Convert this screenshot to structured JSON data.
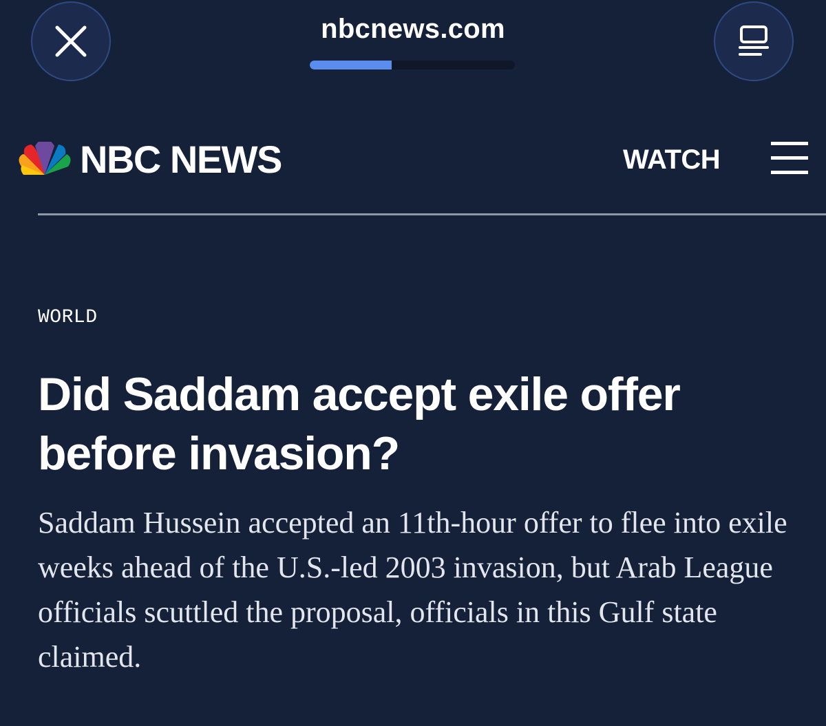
{
  "browser": {
    "url": "nbcnews.com",
    "load_progress": 0.4,
    "close_icon": "close-icon",
    "reader_icon": "reader-mode-icon"
  },
  "site": {
    "logo_text": "NBC NEWS",
    "watch_label": "WATCH",
    "menu_icon": "hamburger-menu-icon"
  },
  "article": {
    "section": "WORLD",
    "headline": "Did Saddam accept exile offer before invasion?",
    "summary": "Saddam Hussein accepted an 11th-hour offer to flee into exile weeks ahead of the U.S.-led 2003 invasion, but Arab League officials scuttled the proposal, officials in this Gulf state claimed."
  },
  "colors": {
    "background": "#152039",
    "accent": "#5b8def",
    "text": "#ffffff",
    "peacock": [
      "#f9a11b",
      "#e4262a",
      "#6e4a9e",
      "#0a7ac3",
      "#1aa44a",
      "#fcc70c"
    ]
  }
}
